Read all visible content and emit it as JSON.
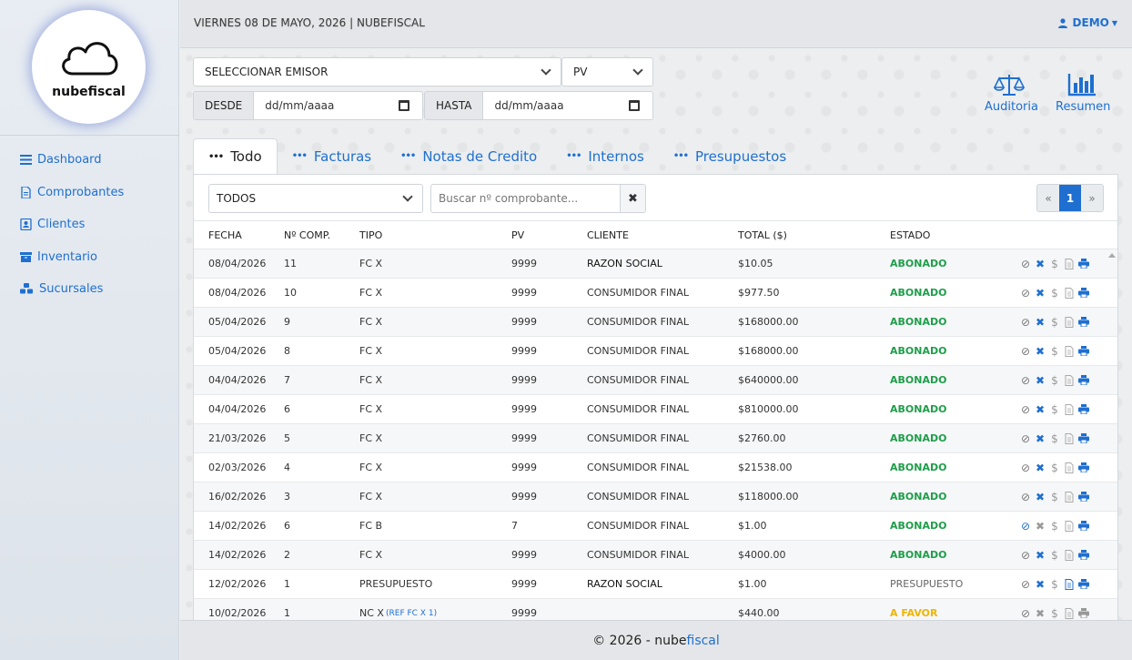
{
  "brand": {
    "name": "nubefiscal"
  },
  "topbar": {
    "date": "VIERNES 08 DE MAYO, 2026 | NUBEFISCAL",
    "user": "DEMO"
  },
  "nav": {
    "items": [
      {
        "label": "Dashboard",
        "icon": "bars-icon"
      },
      {
        "label": "Comprobantes",
        "icon": "document-icon"
      },
      {
        "label": "Clientes",
        "icon": "contact-card-icon"
      },
      {
        "label": "Inventario",
        "icon": "archive-box-icon"
      },
      {
        "label": "Sucursales",
        "icon": "cubes-icon"
      }
    ]
  },
  "filters": {
    "emisor": "SELECCIONAR EMISOR",
    "pv": "PV",
    "desde_label": "DESDE",
    "desde_value": "dd/mm/aaaa",
    "hasta_label": "HASTA",
    "hasta_value": "dd/mm/aaaa"
  },
  "toolbar": {
    "auditoria": "Auditoria",
    "resumen": "Resumen"
  },
  "tabs": [
    "Todo",
    "Facturas",
    "Notas de Credito",
    "Internos",
    "Presupuestos"
  ],
  "table": {
    "filter_value": "TODOS",
    "search_placeholder": "Buscar nº comprobante...",
    "pager": {
      "prev": "«",
      "current": "1",
      "next": "»"
    },
    "columns": [
      "FECHA",
      "Nº COMP.",
      "TIPO",
      "PV",
      "CLIENTE",
      "TOTAL ($)",
      "ESTADO"
    ],
    "rows": [
      {
        "fecha": "08/04/2026",
        "comp": "11",
        "tipo": "FC X",
        "ref": "",
        "pv": "9999",
        "cliente": "RAZON SOCIAL",
        "total": "$10.05",
        "estado": "ABONADO",
        "kind": "ok"
      },
      {
        "fecha": "08/04/2026",
        "comp": "10",
        "tipo": "FC X",
        "ref": "",
        "pv": "9999",
        "cliente": "CONSUMIDOR FINAL",
        "total": "$977.50",
        "estado": "ABONADO",
        "kind": "ok"
      },
      {
        "fecha": "05/04/2026",
        "comp": "9",
        "tipo": "FC X",
        "ref": "",
        "pv": "9999",
        "cliente": "CONSUMIDOR FINAL",
        "total": "$168000.00",
        "estado": "ABONADO",
        "kind": "ok"
      },
      {
        "fecha": "05/04/2026",
        "comp": "8",
        "tipo": "FC X",
        "ref": "",
        "pv": "9999",
        "cliente": "CONSUMIDOR FINAL",
        "total": "$168000.00",
        "estado": "ABONADO",
        "kind": "ok"
      },
      {
        "fecha": "04/04/2026",
        "comp": "7",
        "tipo": "FC X",
        "ref": "",
        "pv": "9999",
        "cliente": "CONSUMIDOR FINAL",
        "total": "$640000.00",
        "estado": "ABONADO",
        "kind": "ok"
      },
      {
        "fecha": "04/04/2026",
        "comp": "6",
        "tipo": "FC X",
        "ref": "",
        "pv": "9999",
        "cliente": "CONSUMIDOR FINAL",
        "total": "$810000.00",
        "estado": "ABONADO",
        "kind": "ok"
      },
      {
        "fecha": "21/03/2026",
        "comp": "5",
        "tipo": "FC X",
        "ref": "",
        "pv": "9999",
        "cliente": "CONSUMIDOR FINAL",
        "total": "$2760.00",
        "estado": "ABONADO",
        "kind": "ok"
      },
      {
        "fecha": "02/03/2026",
        "comp": "4",
        "tipo": "FC X",
        "ref": "",
        "pv": "9999",
        "cliente": "CONSUMIDOR FINAL",
        "total": "$21538.00",
        "estado": "ABONADO",
        "kind": "ok"
      },
      {
        "fecha": "16/02/2026",
        "comp": "3",
        "tipo": "FC X",
        "ref": "",
        "pv": "9999",
        "cliente": "CONSUMIDOR FINAL",
        "total": "$118000.00",
        "estado": "ABONADO",
        "kind": "ok"
      },
      {
        "fecha": "14/02/2026",
        "comp": "6",
        "tipo": "FC B",
        "ref": "",
        "pv": "7",
        "cliente": "CONSUMIDOR FINAL",
        "total": "$1.00",
        "estado": "ABONADO",
        "kind": "fcb"
      },
      {
        "fecha": "14/02/2026",
        "comp": "2",
        "tipo": "FC X",
        "ref": "",
        "pv": "9999",
        "cliente": "CONSUMIDOR FINAL",
        "total": "$4000.00",
        "estado": "ABONADO",
        "kind": "ok"
      },
      {
        "fecha": "12/02/2026",
        "comp": "1",
        "tipo": "PRESUPUESTO",
        "ref": "",
        "pv": "9999",
        "cliente": "RAZON SOCIAL",
        "total": "$1.00",
        "estado": "PRESUPUESTO",
        "kind": "pres"
      },
      {
        "fecha": "10/02/2026",
        "comp": "1",
        "tipo": "NC X",
        "ref": "(REF FC X 1)",
        "pv": "9999",
        "cliente": "",
        "total": "$440.00",
        "estado": "A FAVOR",
        "kind": "nc"
      }
    ]
  },
  "colors": {
    "accent": "#1f6fd0",
    "ok": "#1e9e4a",
    "warn": "#f0b400",
    "muted": "#666666"
  },
  "footer": {
    "prefix": "© 2026 - nube",
    "brand2": "fiscal"
  }
}
